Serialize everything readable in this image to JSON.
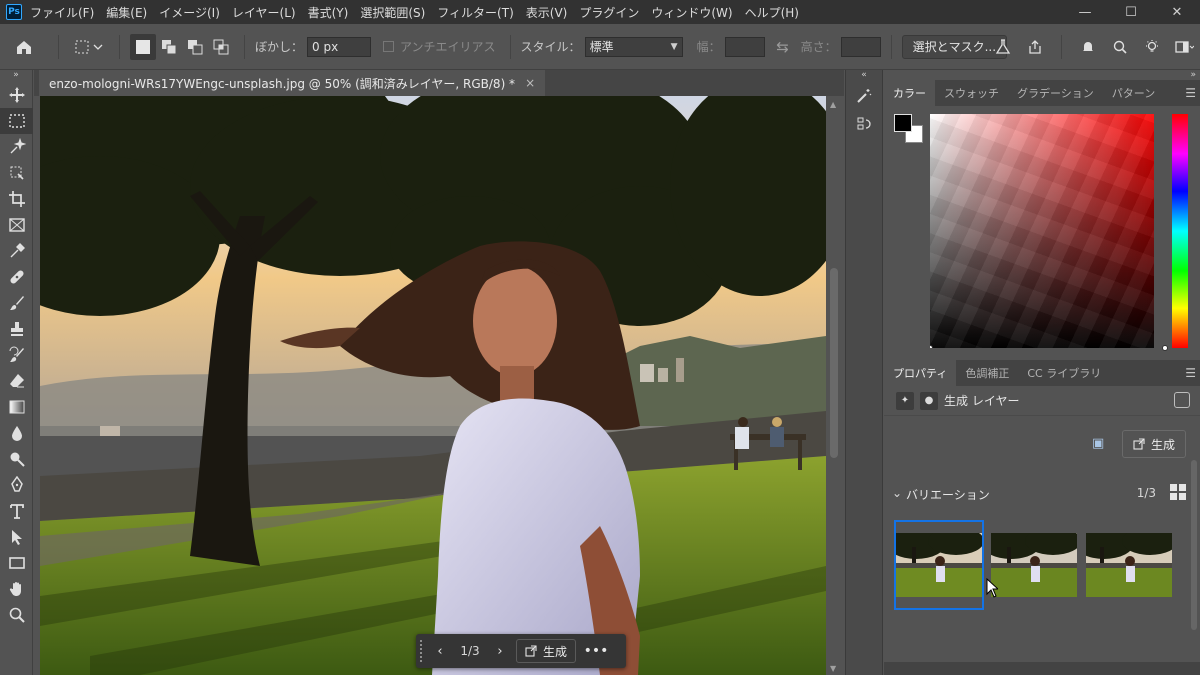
{
  "app": {
    "logo": "Ps",
    "menu": [
      "ファイル(F)",
      "編集(E)",
      "イメージ(I)",
      "レイヤー(L)",
      "書式(Y)",
      "選択範囲(S)",
      "フィルター(T)",
      "表示(V)",
      "プラグイン",
      "ウィンドウ(W)",
      "ヘルプ(H)"
    ],
    "window_controls": [
      "—",
      "☐",
      "✕"
    ]
  },
  "options_bar": {
    "feather_label": "ぼかし：",
    "feather_value": "0 px",
    "antialias_label": "アンチエイリアス",
    "style_label": "スタイル：",
    "style_value": "標準",
    "width_label": "幅：",
    "height_label": "高さ：",
    "select_mask_button": "選択とマスク..."
  },
  "document": {
    "tab_title": "enzo-mologni-WRs17YWEngc-unsplash.jpg @ 50% (調和済みレイヤー, RGB/8) *",
    "close": "×"
  },
  "taskbar": {
    "prev": "‹",
    "count": "1/3",
    "next": "›",
    "generate_label": "生成",
    "more": "•••"
  },
  "color_panel": {
    "tabs": [
      "カラー",
      "スウォッチ",
      "グラデーション",
      "パターン"
    ],
    "foreground": "#000000",
    "background": "#ffffff"
  },
  "properties_panel": {
    "tabs": [
      "プロパティ",
      "色調補正",
      "CC ライブラリ"
    ],
    "layer_label": "生成 レイヤー",
    "generate_button": "生成",
    "variations_title": "バリエーション",
    "variations_count": "1/3",
    "selected_variation": 1
  },
  "icons": {
    "toolbar": [
      "move-icon",
      "marquee-icon",
      "object-select-icon",
      "crop-frame-icon",
      "crop-icon",
      "frame-icon",
      "eyedropper-icon",
      "healing-brush-icon",
      "brush-icon",
      "stamp-icon",
      "history-brush-icon",
      "eraser-icon",
      "gradient-icon",
      "blur-icon",
      "dodge-icon",
      "pen-icon",
      "type-icon",
      "path-select-icon",
      "rectangle-icon",
      "hand-icon",
      "zoom-icon"
    ]
  },
  "colors": {
    "accent": "#1473e6",
    "chrome_dark": "#323232",
    "panel": "#535353"
  }
}
